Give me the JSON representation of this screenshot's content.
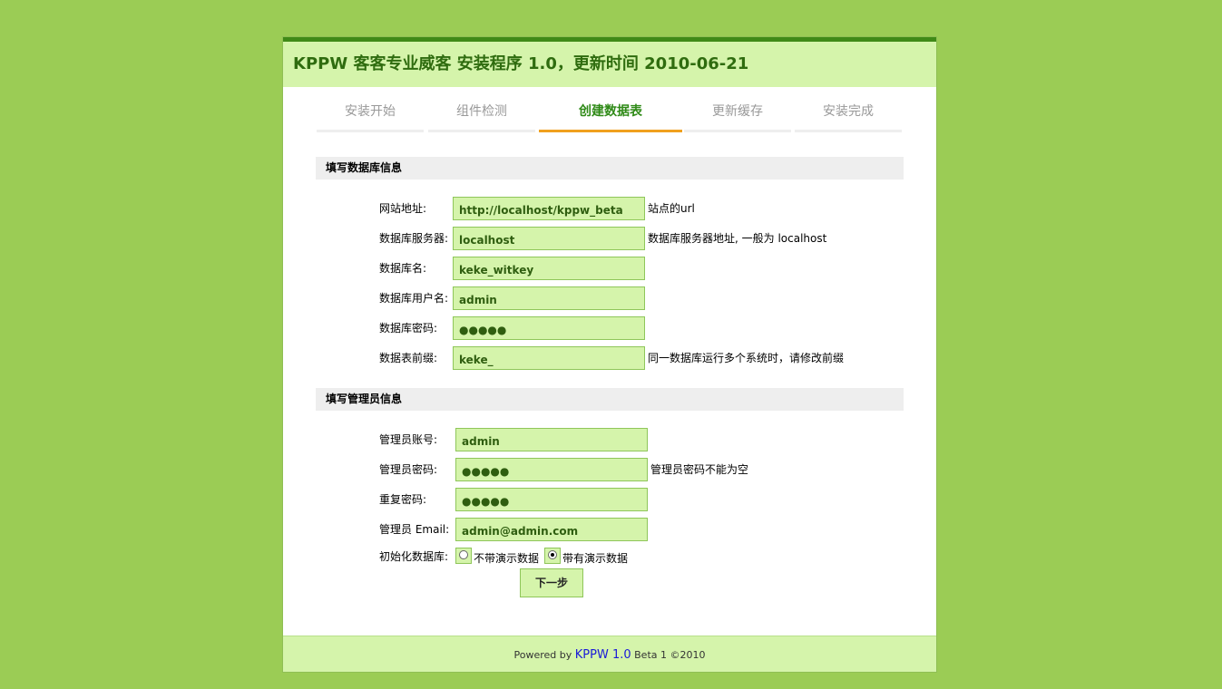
{
  "header": {
    "title": "KPPW 客客专业威客 安装程序 1.0，更新时间 2010-06-21"
  },
  "steps": [
    {
      "label": "安装开始"
    },
    {
      "label": "组件检测"
    },
    {
      "label": "创建数据表"
    },
    {
      "label": "更新缓存"
    },
    {
      "label": "安装完成"
    }
  ],
  "active_step": "创建数据表",
  "db_section": {
    "heading": "填写数据库信息",
    "rows": [
      {
        "label": "网站地址:",
        "value": "http://localhost/kppw_beta",
        "hint": "站点的url"
      },
      {
        "label": "数据库服务器:",
        "value": "localhost",
        "hint": "数据库服务器地址, 一般为  localhost"
      },
      {
        "label": "数据库名:",
        "value": "keke_witkey",
        "hint": ""
      },
      {
        "label": "数据库用户名:",
        "value": "admin",
        "hint": ""
      },
      {
        "label": "数据库密码:",
        "value": "●●●●●",
        "hint": ""
      },
      {
        "label": "数据表前缀:",
        "value": "keke_",
        "hint": "同一数据库运行多个系统时，请修改前缀"
      }
    ]
  },
  "admin_section": {
    "heading": "填写管理员信息",
    "rows": [
      {
        "label": "管理员账号:",
        "value": "admin",
        "hint": ""
      },
      {
        "label": "管理员密码:",
        "value": "●●●●●",
        "hint": "管理员密码不能为空"
      },
      {
        "label": "重复密码:",
        "value": "●●●●●",
        "hint": ""
      },
      {
        "label": "管理员  Email:",
        "value": "admin@admin.com",
        "hint": ""
      }
    ],
    "init_db": {
      "label": "初始化数据库:",
      "options": [
        {
          "label": "不带演示数据",
          "checked": false
        },
        {
          "label": "带有演示数据",
          "checked": true
        }
      ]
    }
  },
  "next_button": "下一步",
  "footer": {
    "prefix": "Powered by",
    "brand": "KPPW 1.0",
    "suffix": "Beta 1 ©2010"
  },
  "colors": {
    "background": "#9bcc55",
    "header_bg": "#d5f4ab",
    "header_text": "#2f6c0f",
    "active_step_text": "#2f8a17",
    "active_step_underline": "#f0a01e",
    "field_bg": "#d5f4ab",
    "footer_brand": "#1a1ad8"
  }
}
